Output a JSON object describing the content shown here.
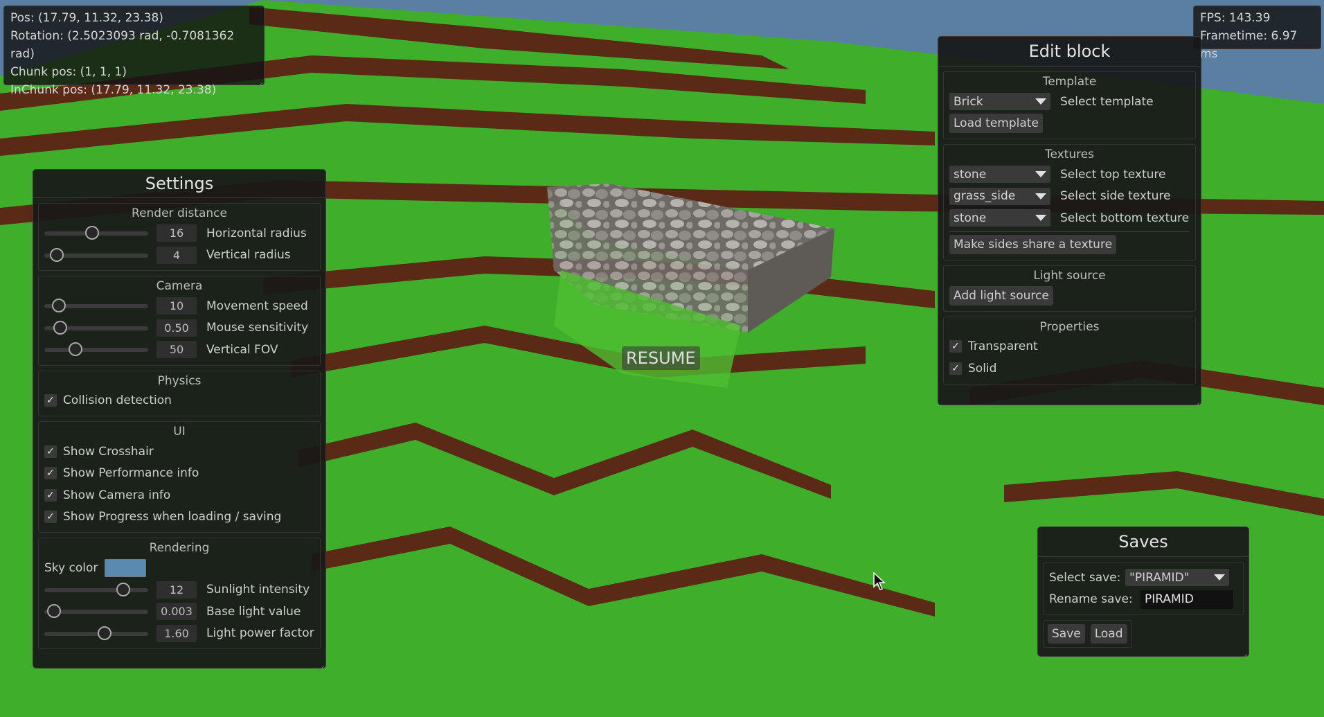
{
  "colors": {
    "sky": "#5a7fa3",
    "grass": "#3fae2a",
    "dirt": "#5a2a16",
    "stone": "#8d8a86",
    "water": "#4a8fd6",
    "panel_bg": "#181818",
    "sky_swatch": "#5b8ab0"
  },
  "camera_info": {
    "pos": "Pos: (17.79, 11.32, 23.38)",
    "rotation": "Rotation: (2.5023093 rad, -0.7081362 rad)",
    "chunk_pos": "Chunk pos: (1, 1, 1)",
    "inchunk_pos": "InChunk pos: (17.79, 11.32, 23.38)"
  },
  "performance": {
    "fps": "FPS: 143.39",
    "frametime": "Frametime: 6.97 ms"
  },
  "resume_label": "RESUME",
  "settings": {
    "title": "Settings",
    "render_distance": {
      "title": "Render distance",
      "horizontal": {
        "value": "16",
        "label": "Horizontal radius",
        "fraction": 0.46
      },
      "vertical": {
        "value": "4",
        "label": "Vertical radius",
        "fraction": 0.12
      }
    },
    "camera": {
      "title": "Camera",
      "movement_speed": {
        "value": "10",
        "label": "Movement speed",
        "fraction": 0.14
      },
      "mouse_sensitivity": {
        "value": "0.50",
        "label": "Mouse sensitivity",
        "fraction": 0.15
      },
      "vertical_fov": {
        "value": "50",
        "label": "Vertical FOV",
        "fraction": 0.3
      }
    },
    "physics": {
      "title": "Physics",
      "collision": "Collision detection"
    },
    "ui": {
      "title": "UI",
      "crosshair": "Show Crosshair",
      "performance": "Show Performance info",
      "camera": "Show Camera info",
      "progress": "Show Progress when loading / saving"
    },
    "rendering": {
      "title": "Rendering",
      "sky_color_label": "Sky color",
      "sunlight": {
        "value": "12",
        "label": "Sunlight intensity",
        "fraction": 0.76
      },
      "base_light": {
        "value": "0.003",
        "label": "Base light value",
        "fraction": 0.09
      },
      "light_power": {
        "value": "1.60",
        "label": "Light power factor",
        "fraction": 0.58
      }
    }
  },
  "edit_block": {
    "title": "Edit block",
    "template": {
      "title": "Template",
      "selected": "Brick",
      "select_label": "Select template",
      "load_button": "Load template"
    },
    "textures": {
      "title": "Textures",
      "top": {
        "value": "stone",
        "label": "Select top texture"
      },
      "side": {
        "value": "grass_side",
        "label": "Select side texture"
      },
      "bottom": {
        "value": "stone",
        "label": "Select bottom texture"
      },
      "share_button": "Make sides share a texture"
    },
    "light_source": {
      "title": "Light source",
      "add_button": "Add light source"
    },
    "properties": {
      "title": "Properties",
      "transparent": "Transparent",
      "solid": "Solid"
    }
  },
  "saves": {
    "title": "Saves",
    "select_label": "Select save:",
    "selected": "\"PIRAMID\"",
    "rename_label": "Rename save:",
    "rename_value": "PIRAMID",
    "save_button": "Save",
    "load_button": "Load"
  }
}
